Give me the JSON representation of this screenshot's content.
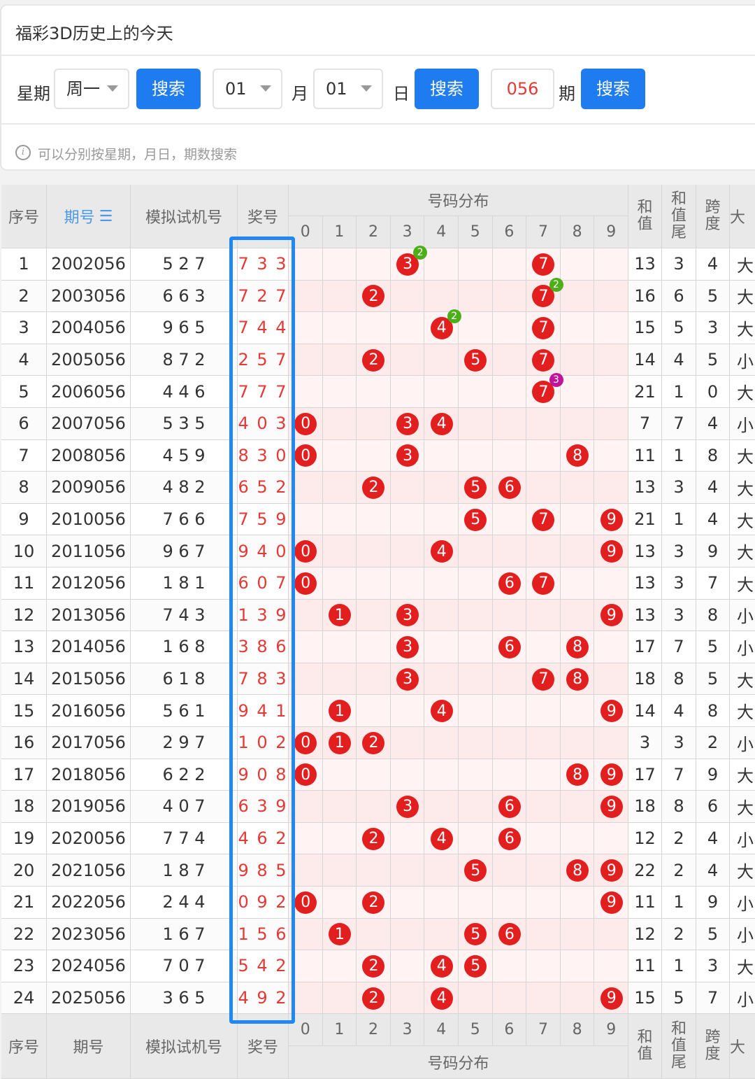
{
  "page": {
    "title": "福彩3D历史上的今天",
    "filters": {
      "weekday_label": "星期",
      "weekday_value": "周一",
      "search_label": "搜索",
      "month_value": "01",
      "month_label": "月",
      "day_value": "01",
      "day_label": "日",
      "period_value": "056",
      "period_label": "期"
    },
    "hint": "可以分别按星期，月日，期数搜索",
    "hint_icon": "info-icon"
  },
  "table": {
    "headers": {
      "seq": "序号",
      "period": "期号",
      "period_sort_icon": "☰",
      "sim": "模拟试机号",
      "prize": "奖号",
      "dist": "号码分布",
      "sum": "和值",
      "sum_tail": "和值尾",
      "span": "跨度",
      "size": "大"
    },
    "digits": [
      "0",
      "1",
      "2",
      "3",
      "4",
      "5",
      "6",
      "7",
      "8",
      "9"
    ],
    "rows": [
      {
        "seq": "1",
        "period": "2002056",
        "sim": "5 2 7",
        "prize": "7 3 3",
        "balls": [
          3,
          7
        ],
        "marks": [
          {
            "d": 3,
            "n": "2",
            "c": "#4caf1a"
          }
        ],
        "sum": "13",
        "tail": "3",
        "span": "4",
        "size": "大"
      },
      {
        "seq": "2",
        "period": "2003056",
        "sim": "6 6 3",
        "prize": "7 2 7",
        "balls": [
          2,
          7
        ],
        "marks": [
          {
            "d": 7,
            "n": "2",
            "c": "#4caf1a"
          }
        ],
        "sum": "16",
        "tail": "6",
        "span": "5",
        "size": "大"
      },
      {
        "seq": "3",
        "period": "2004056",
        "sim": "9 6 5",
        "prize": "7 4 4",
        "balls": [
          4,
          7
        ],
        "marks": [
          {
            "d": 4,
            "n": "2",
            "c": "#4caf1a"
          }
        ],
        "sum": "15",
        "tail": "5",
        "span": "3",
        "size": "大"
      },
      {
        "seq": "4",
        "period": "2005056",
        "sim": "8 7 2",
        "prize": "2 5 7",
        "balls": [
          2,
          5,
          7
        ],
        "marks": [],
        "sum": "14",
        "tail": "4",
        "span": "5",
        "size": "小"
      },
      {
        "seq": "5",
        "period": "2006056",
        "sim": "4 4 6",
        "prize": "7 7 7",
        "balls": [
          7
        ],
        "marks": [
          {
            "d": 7,
            "n": "3",
            "c": "#c0139b"
          }
        ],
        "sum": "21",
        "tail": "1",
        "span": "0",
        "size": "大"
      },
      {
        "seq": "6",
        "period": "2007056",
        "sim": "5 3 5",
        "prize": "4 0 3",
        "balls": [
          0,
          3,
          4
        ],
        "marks": [],
        "sum": "7",
        "tail": "7",
        "span": "4",
        "size": "小"
      },
      {
        "seq": "7",
        "period": "2008056",
        "sim": "4 5 9",
        "prize": "8 3 0",
        "balls": [
          0,
          3,
          8
        ],
        "marks": [],
        "sum": "11",
        "tail": "1",
        "span": "8",
        "size": "大"
      },
      {
        "seq": "8",
        "period": "2009056",
        "sim": "4 8 2",
        "prize": "6 5 2",
        "balls": [
          2,
          5,
          6
        ],
        "marks": [],
        "sum": "13",
        "tail": "3",
        "span": "4",
        "size": "大"
      },
      {
        "seq": "9",
        "period": "2010056",
        "sim": "7 6 6",
        "prize": "7 5 9",
        "balls": [
          5,
          7,
          9
        ],
        "marks": [],
        "sum": "21",
        "tail": "1",
        "span": "4",
        "size": "大"
      },
      {
        "seq": "10",
        "period": "2011056",
        "sim": "9 6 7",
        "prize": "9 4 0",
        "balls": [
          0,
          4,
          9
        ],
        "marks": [],
        "sum": "13",
        "tail": "3",
        "span": "9",
        "size": "大"
      },
      {
        "seq": "11",
        "period": "2012056",
        "sim": "1 8 1",
        "prize": "6 0 7",
        "balls": [
          0,
          6,
          7
        ],
        "marks": [],
        "sum": "13",
        "tail": "3",
        "span": "7",
        "size": "大"
      },
      {
        "seq": "12",
        "period": "2013056",
        "sim": "7 4 3",
        "prize": "1 3 9",
        "balls": [
          1,
          3,
          9
        ],
        "marks": [],
        "sum": "13",
        "tail": "3",
        "span": "8",
        "size": "小"
      },
      {
        "seq": "13",
        "period": "2014056",
        "sim": "1 6 8",
        "prize": "3 8 6",
        "balls": [
          3,
          6,
          8
        ],
        "marks": [],
        "sum": "17",
        "tail": "7",
        "span": "5",
        "size": "小"
      },
      {
        "seq": "14",
        "period": "2015056",
        "sim": "6 1 8",
        "prize": "7 8 3",
        "balls": [
          3,
          7,
          8
        ],
        "marks": [],
        "sum": "18",
        "tail": "8",
        "span": "5",
        "size": "大"
      },
      {
        "seq": "15",
        "period": "2016056",
        "sim": "5 6 1",
        "prize": "9 4 1",
        "balls": [
          1,
          4,
          9
        ],
        "marks": [],
        "sum": "14",
        "tail": "4",
        "span": "8",
        "size": "大"
      },
      {
        "seq": "16",
        "period": "2017056",
        "sim": "2 9 7",
        "prize": "1 0 2",
        "balls": [
          0,
          1,
          2
        ],
        "marks": [],
        "sum": "3",
        "tail": "3",
        "span": "2",
        "size": "小"
      },
      {
        "seq": "17",
        "period": "2018056",
        "sim": "6 2 2",
        "prize": "9 0 8",
        "balls": [
          0,
          8,
          9
        ],
        "marks": [],
        "sum": "17",
        "tail": "7",
        "span": "9",
        "size": "大"
      },
      {
        "seq": "18",
        "period": "2019056",
        "sim": "4 0 7",
        "prize": "6 3 9",
        "balls": [
          3,
          6,
          9
        ],
        "marks": [],
        "sum": "18",
        "tail": "8",
        "span": "6",
        "size": "大"
      },
      {
        "seq": "19",
        "period": "2020056",
        "sim": "7 7 4",
        "prize": "4 6 2",
        "balls": [
          2,
          4,
          6
        ],
        "marks": [],
        "sum": "12",
        "tail": "2",
        "span": "4",
        "size": "小"
      },
      {
        "seq": "20",
        "period": "2021056",
        "sim": "1 8 7",
        "prize": "9 8 5",
        "balls": [
          5,
          8,
          9
        ],
        "marks": [],
        "sum": "22",
        "tail": "2",
        "span": "4",
        "size": "大"
      },
      {
        "seq": "21",
        "period": "2022056",
        "sim": "2 4 4",
        "prize": "0 9 2",
        "balls": [
          0,
          2,
          9
        ],
        "marks": [],
        "sum": "11",
        "tail": "1",
        "span": "9",
        "size": "小"
      },
      {
        "seq": "22",
        "period": "2023056",
        "sim": "1 6 7",
        "prize": "1 5 6",
        "balls": [
          1,
          5,
          6
        ],
        "marks": [],
        "sum": "12",
        "tail": "2",
        "span": "5",
        "size": "小"
      },
      {
        "seq": "23",
        "period": "2024056",
        "sim": "7 0 7",
        "prize": "5 4 2",
        "balls": [
          2,
          4,
          5
        ],
        "marks": [],
        "sum": "11",
        "tail": "1",
        "span": "3",
        "size": "大"
      },
      {
        "seq": "24",
        "period": "2025056",
        "sim": "3 6 5",
        "prize": "4 9 2",
        "balls": [
          2,
          4,
          9
        ],
        "marks": [],
        "sum": "15",
        "tail": "5",
        "span": "7",
        "size": "小"
      }
    ]
  },
  "colors": {
    "accent": "#1e7bf0",
    "ball": "#e31e1e",
    "prize_text": "#e53935",
    "highlight_box": "#2088f5",
    "mark_green": "#4caf1a",
    "mark_purple": "#c0139b"
  }
}
